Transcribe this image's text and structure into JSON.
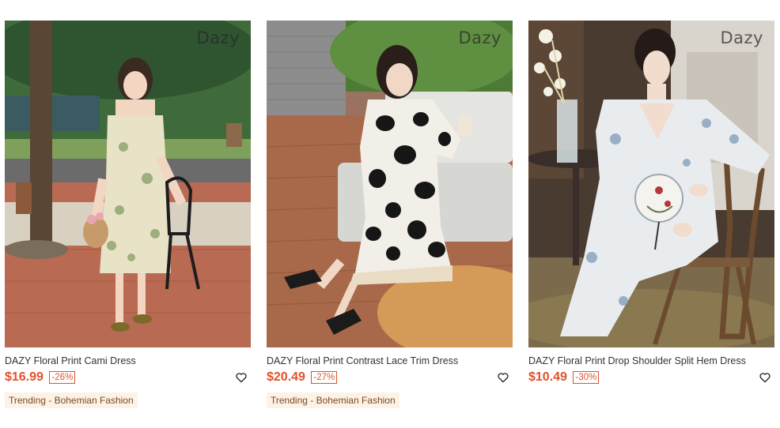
{
  "products": [
    {
      "brand": "Dazy",
      "title": "DAZY Floral Print Cami Dress",
      "price": "$16.99",
      "discount": "-26%",
      "tag": "Trending - Bohemian Fashion",
      "image_icon": "product-photo"
    },
    {
      "brand": "Dazy",
      "title": "DAZY Floral Print Contrast Lace Trim Dress",
      "price": "$20.49",
      "discount": "-27%",
      "tag": "Trending - Bohemian Fashion",
      "image_icon": "product-photo"
    },
    {
      "brand": "Dazy",
      "title": "DAZY Floral Print Drop Shoulder Split Hem Dress",
      "price": "$10.49",
      "discount": "-30%",
      "tag": "",
      "image_icon": "product-photo"
    }
  ],
  "icons": {
    "wishlist": "heart-outline-icon"
  },
  "colors": {
    "price": "#e0522b",
    "tag_bg": "#fdf2e6",
    "tag_text": "#7a4a22",
    "title": "#333333"
  }
}
